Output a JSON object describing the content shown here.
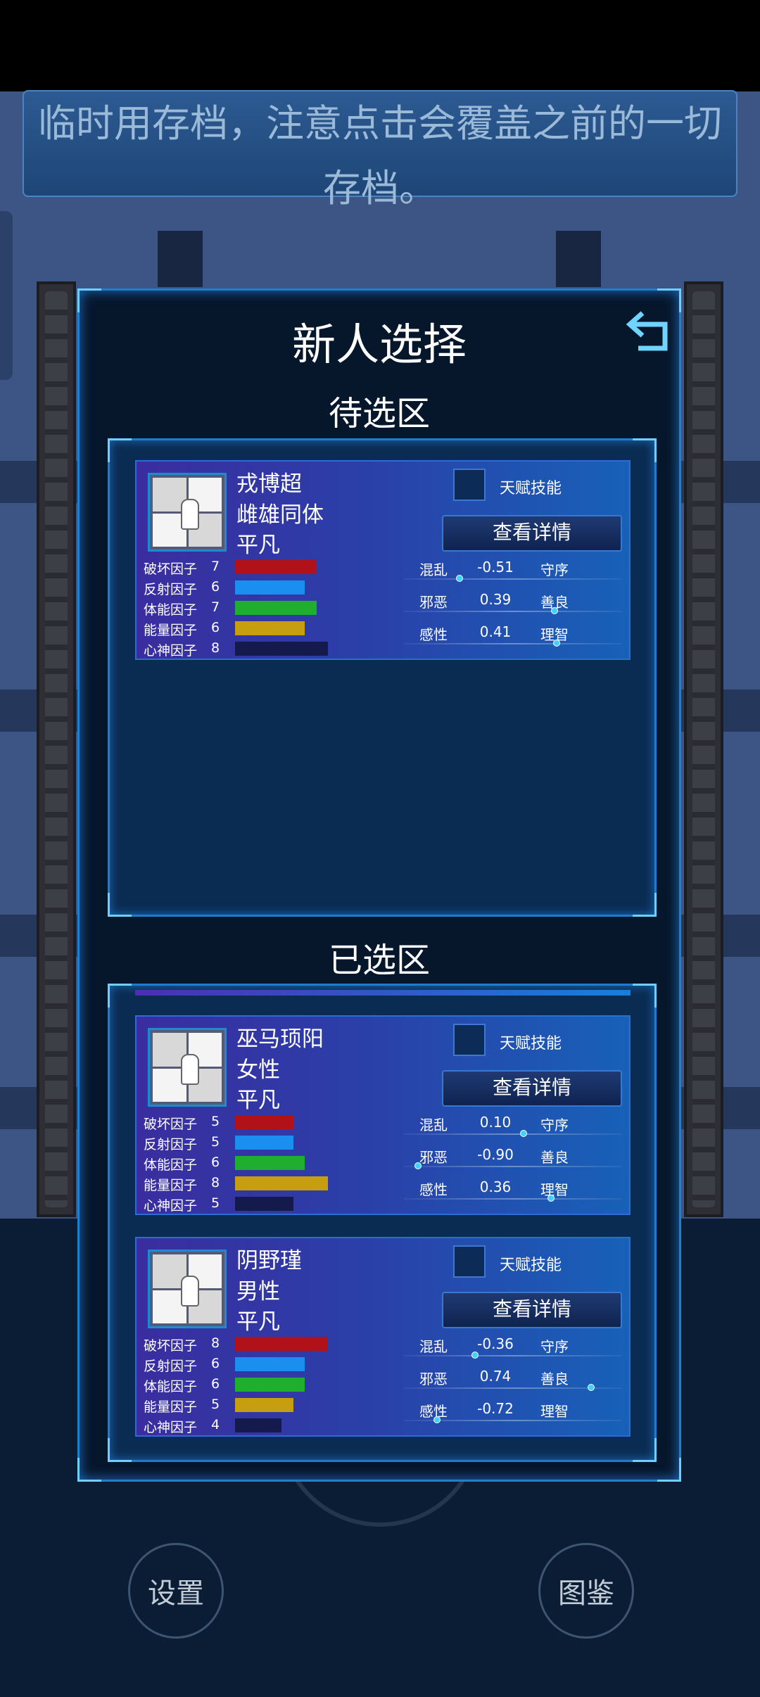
{
  "notice": {
    "text": "临时用存档，注意点击会覆盖之前的一切存档。"
  },
  "dialog": {
    "title": "新人选择",
    "back_icon": "back-arrow-icon",
    "candidates_title": "待选区",
    "selected_title": "已选区"
  },
  "bottom_nav": {
    "settings_label": "设置",
    "atlas_label": "图鉴"
  },
  "stat_labels": [
    "破坏因子",
    "反射因子",
    "体能因子",
    "能量因子",
    "心神因子"
  ],
  "stat_colors": [
    "#b11118",
    "#1a8ff0",
    "#1fae2e",
    "#c79e10",
    "#141a4c"
  ],
  "talent_label": "天赋技能",
  "detail_label": "查看详情",
  "candidates": [
    {
      "name": "戎博超",
      "gender": "雌雄同体",
      "rank": "平凡",
      "stats": [
        7,
        6,
        7,
        6,
        8
      ],
      "traits": [
        {
          "left": "混乱",
          "value": "-0.51",
          "right": "守序",
          "pos": -0.51
        },
        {
          "left": "邪恶",
          "value": "0.39",
          "right": "善良",
          "pos": 0.39
        },
        {
          "left": "感性",
          "value": "0.41",
          "right": "理智",
          "pos": 0.41
        }
      ]
    }
  ],
  "selected": [
    {
      "name": "巫马顼阳",
      "gender": "女性",
      "rank": "平凡",
      "stats": [
        5,
        5,
        6,
        8,
        5
      ],
      "traits": [
        {
          "left": "混乱",
          "value": "0.10",
          "right": "守序",
          "pos": 0.1
        },
        {
          "left": "邪恶",
          "value": "-0.90",
          "right": "善良",
          "pos": -0.9
        },
        {
          "left": "感性",
          "value": "0.36",
          "right": "理智",
          "pos": 0.36
        }
      ]
    },
    {
      "name": "阴野瑾",
      "gender": "男性",
      "rank": "平凡",
      "stats": [
        8,
        6,
        6,
        5,
        4
      ],
      "traits": [
        {
          "left": "混乱",
          "value": "-0.36",
          "right": "守序",
          "pos": -0.36
        },
        {
          "left": "邪恶",
          "value": "0.74",
          "right": "善良",
          "pos": 0.74
        },
        {
          "left": "感性",
          "value": "-0.72",
          "right": "理智",
          "pos": -0.72
        }
      ]
    }
  ]
}
